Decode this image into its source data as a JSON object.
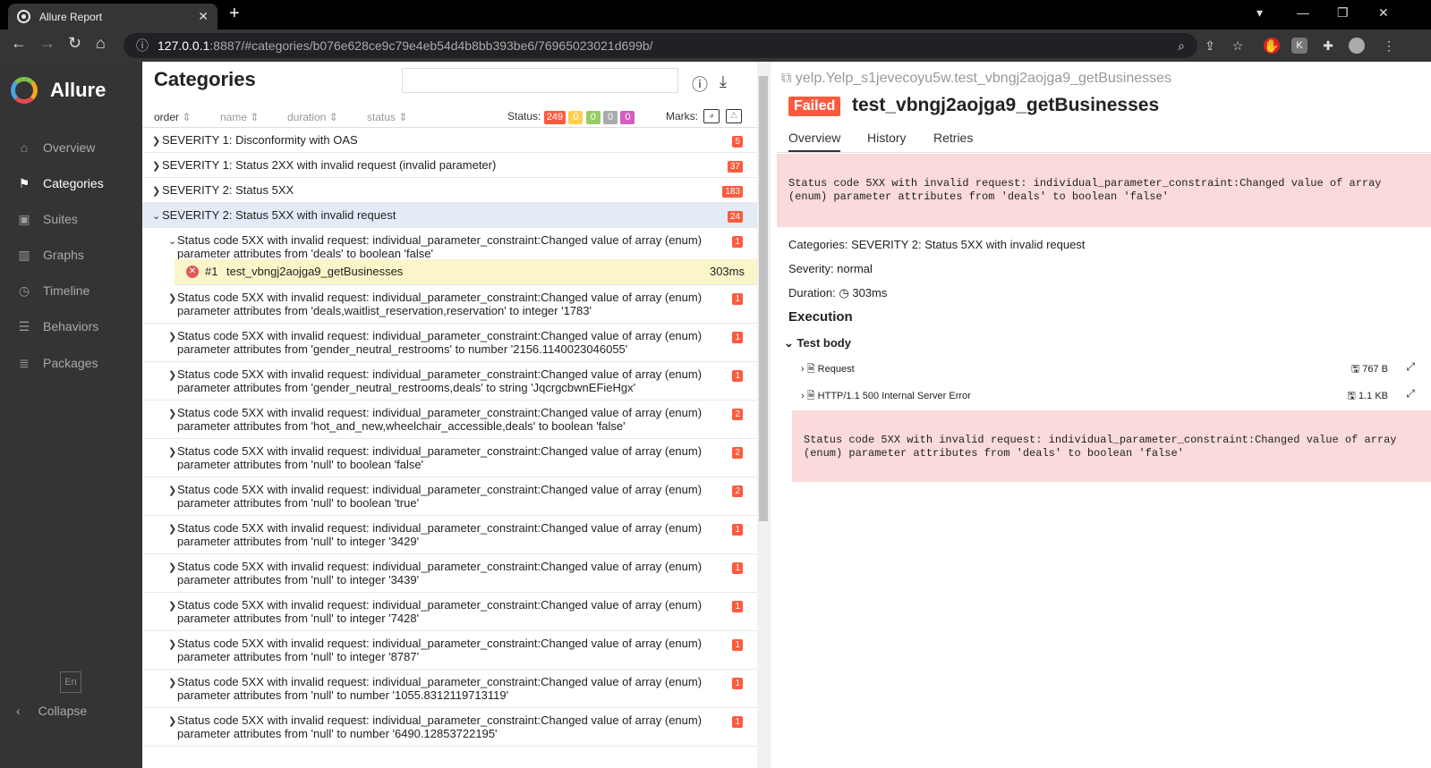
{
  "browser": {
    "tab_title": "Allure Report",
    "url_host": "127.0.0.1",
    "url_path": ":8887/#categories/b076e628ce9c79e4eb54d4b8bb393be6/76965023021d699b/"
  },
  "sidebar": {
    "brand": "Allure",
    "items": [
      {
        "label": "Overview",
        "icon": "home-icon"
      },
      {
        "label": "Categories",
        "icon": "flag-icon"
      },
      {
        "label": "Suites",
        "icon": "briefcase-icon"
      },
      {
        "label": "Graphs",
        "icon": "bar-chart-icon"
      },
      {
        "label": "Timeline",
        "icon": "clock-icon"
      },
      {
        "label": "Behaviors",
        "icon": "list-icon"
      },
      {
        "label": "Packages",
        "icon": "stack-icon"
      }
    ],
    "lang": "En",
    "collapse": "Collapse"
  },
  "categories": {
    "title": "Categories",
    "sort": {
      "order": "order",
      "name": "name",
      "duration": "duration",
      "status": "status"
    },
    "status_label": "Status:",
    "status_counts": [
      "249",
      "0",
      "0",
      "0",
      "0"
    ],
    "marks_label": "Marks:",
    "groups": [
      {
        "label": "SEVERITY 1: Disconformity with OAS",
        "count": "5"
      },
      {
        "label": "SEVERITY 1: Status 2XX with invalid request (invalid parameter)",
        "count": "37"
      },
      {
        "label": "SEVERITY 2: Status 5XX",
        "count": "183"
      },
      {
        "label": "SEVERITY 2: Status 5XX with invalid request",
        "count": "24"
      }
    ],
    "test": {
      "num": "#1",
      "name": "test_vbngj2aojga9_getBusinesses",
      "duration": "303ms"
    },
    "children": [
      {
        "l1": "Status code 5XX with invalid request: individual_parameter_constraint:Changed value of array (enum)",
        "l2": "parameter attributes from 'deals' to boolean 'false'",
        "count": "1"
      },
      {
        "l1": "Status code 5XX with invalid request: individual_parameter_constraint:Changed value of array (enum)",
        "l2": "parameter attributes from 'deals,waitlist_reservation,reservation' to integer '1783'",
        "count": "1"
      },
      {
        "l1": "Status code 5XX with invalid request: individual_parameter_constraint:Changed value of array (enum)",
        "l2": "parameter attributes from 'gender_neutral_restrooms' to number '2156.1140023046055'",
        "count": "1"
      },
      {
        "l1": "Status code 5XX with invalid request: individual_parameter_constraint:Changed value of array (enum)",
        "l2": "parameter attributes from 'gender_neutral_restrooms,deals' to string 'JqcrgcbwnEFieHgx'",
        "count": "1"
      },
      {
        "l1": "Status code 5XX with invalid request: individual_parameter_constraint:Changed value of array (enum)",
        "l2": "parameter attributes from 'hot_and_new,wheelchair_accessible,deals' to boolean 'false'",
        "count": "2"
      },
      {
        "l1": "Status code 5XX with invalid request: individual_parameter_constraint:Changed value of array (enum)",
        "l2": "parameter attributes from 'null' to boolean 'false'",
        "count": "2"
      },
      {
        "l1": "Status code 5XX with invalid request: individual_parameter_constraint:Changed value of array (enum)",
        "l2": "parameter attributes from 'null' to boolean 'true'",
        "count": "2"
      },
      {
        "l1": "Status code 5XX with invalid request: individual_parameter_constraint:Changed value of array (enum)",
        "l2": "parameter attributes from 'null' to integer '3429'",
        "count": "1"
      },
      {
        "l1": "Status code 5XX with invalid request: individual_parameter_constraint:Changed value of array (enum)",
        "l2": "parameter attributes from 'null' to integer '3439'",
        "count": "1"
      },
      {
        "l1": "Status code 5XX with invalid request: individual_parameter_constraint:Changed value of array (enum)",
        "l2": "parameter attributes from 'null' to integer '7428'",
        "count": "1"
      },
      {
        "l1": "Status code 5XX with invalid request: individual_parameter_constraint:Changed value of array (enum)",
        "l2": "parameter attributes from 'null' to integer '8787'",
        "count": "1"
      },
      {
        "l1": "Status code 5XX with invalid request: individual_parameter_constraint:Changed value of array (enum)",
        "l2": "parameter attributes from 'null' to number '1055.8312119713119'",
        "count": "1"
      },
      {
        "l1": "Status code 5XX with invalid request: individual_parameter_constraint:Changed value of array (enum)",
        "l2": "parameter attributes from 'null' to number '6490.12853722195'",
        "count": "1"
      }
    ]
  },
  "detail": {
    "breadcrumb": "yelp.Yelp_s1jevecoyu5w.test_vbngj2aojga9_getBusinesses",
    "status": "Failed",
    "title": "test_vbngj2aojga9_getBusinesses",
    "tabs": [
      "Overview",
      "History",
      "Retries"
    ],
    "error": "Status code 5XX with invalid request: individual_parameter_constraint:Changed value of array (enum) parameter attributes from 'deals' to boolean 'false'",
    "categories": "Categories: SEVERITY 2: Status 5XX with invalid request",
    "severity": "Severity: normal",
    "duration_label": "Duration:",
    "duration": "303ms",
    "execution": "Execution",
    "test_body": "Test body",
    "attachments": [
      {
        "name": "Request",
        "size": "767 B"
      },
      {
        "name": "HTTP/1.1 500 Internal Server Error",
        "size": "1.1 KB"
      }
    ]
  },
  "colors": {
    "failed": "#fd5a3e",
    "broken": "#ffd050",
    "passed": "#97cc64",
    "skipped": "#aaaaaa",
    "unknown": "#d35ebe"
  }
}
